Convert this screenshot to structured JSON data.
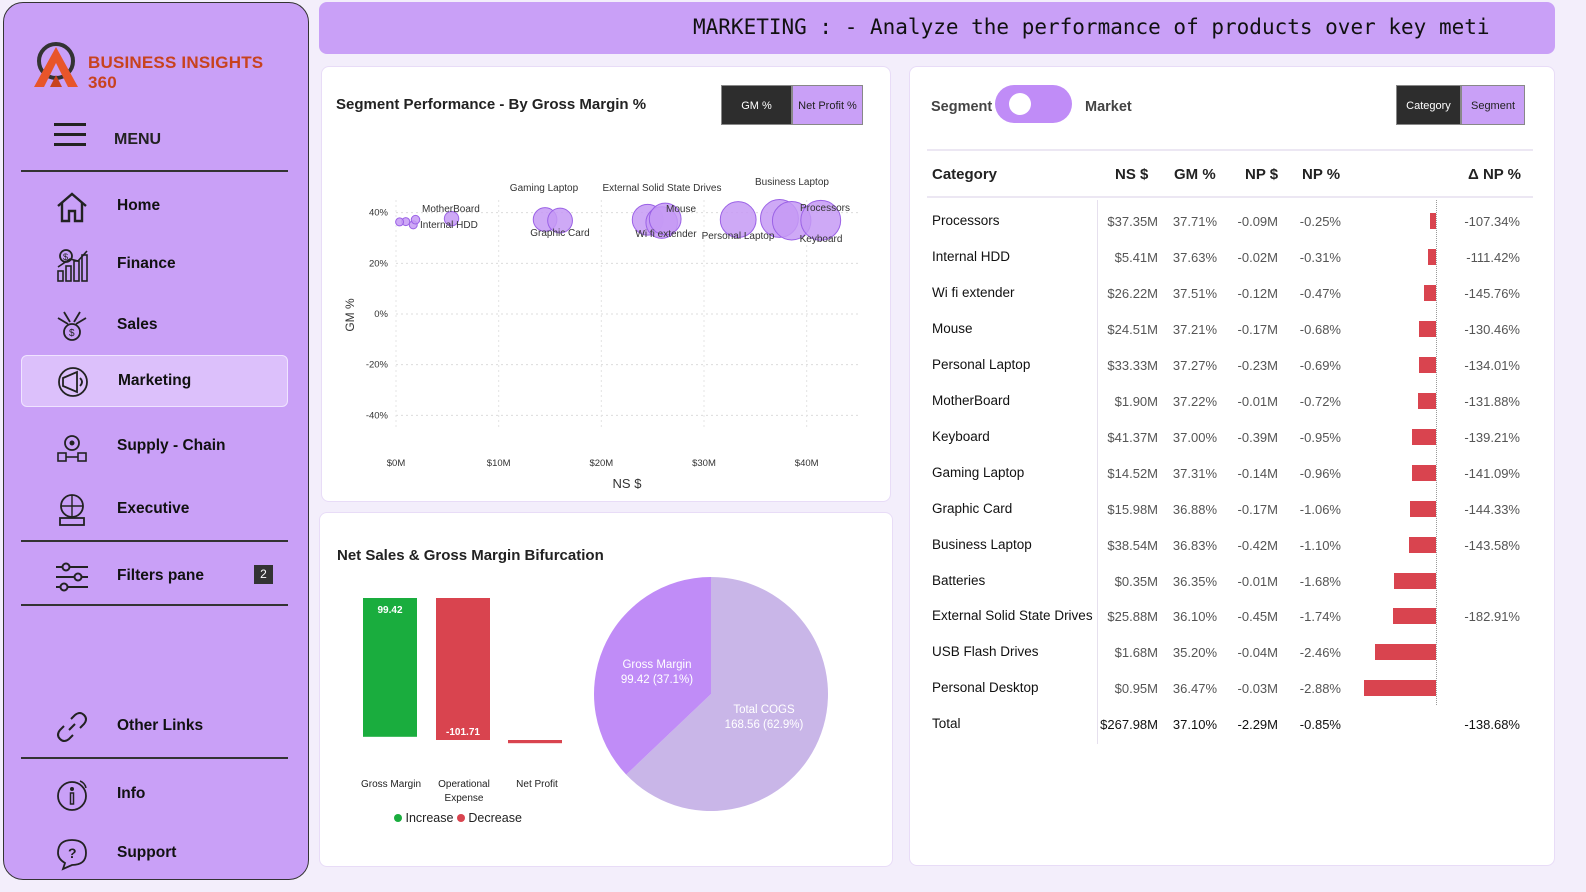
{
  "app": {
    "brand": "BUSINESS INSIGHTS 360",
    "banner_text": "MARKETING : - Analyze the performance of products over key meti"
  },
  "sidebar": {
    "menu_label": "MENU",
    "items": [
      {
        "label": "Home",
        "icon": "home-icon"
      },
      {
        "label": "Finance",
        "icon": "finance-icon"
      },
      {
        "label": "Sales",
        "icon": "sales-icon"
      },
      {
        "label": "Marketing",
        "icon": "marketing-icon",
        "active": true
      },
      {
        "label": "Supply - Chain",
        "icon": "supply-chain-icon"
      },
      {
        "label": "Executive",
        "icon": "executive-icon"
      },
      {
        "label": "Filters pane",
        "icon": "filters-icon",
        "badge": "2"
      },
      {
        "label": "Other Links",
        "icon": "link-icon"
      },
      {
        "label": "Info",
        "icon": "info-icon"
      },
      {
        "label": "Support",
        "icon": "support-icon"
      }
    ]
  },
  "segment_card": {
    "title": "Segment Performance - By Gross Margin %",
    "btn_gm": "GM %",
    "btn_np": "Net Profit %"
  },
  "bifurcation_card": {
    "title": "Net Sales & Gross Margin Bifurcation",
    "legend_increase": "Increase",
    "legend_decrease": "Decrease",
    "pie_gm_label": "Gross Margin",
    "pie_gm_value": "99.42 (37.1%)",
    "pie_cogs_label": "Total COGS",
    "pie_cogs_value": "168.56 (62.9%)"
  },
  "table_card": {
    "toggle_left": "Segment",
    "toggle_right": "Market",
    "btn_category": "Category",
    "btn_segment": "Segment",
    "headers": [
      "Category",
      "NS $",
      "GM %",
      "NP $",
      "NP %",
      "Δ NP %"
    ],
    "rows": [
      {
        "cat": "Processors",
        "ns": "$37.35M",
        "gm": "37.71%",
        "npd": "-0.09M",
        "npp": "-0.25%",
        "dnp": "-107.34%",
        "bar": -0.25
      },
      {
        "cat": "Internal HDD",
        "ns": "$5.41M",
        "gm": "37.63%",
        "npd": "-0.02M",
        "npp": "-0.31%",
        "dnp": "-111.42%",
        "bar": -0.31
      },
      {
        "cat": "Wi fi extender",
        "ns": "$26.22M",
        "gm": "37.51%",
        "npd": "-0.12M",
        "npp": "-0.47%",
        "dnp": "-145.76%",
        "bar": -0.47
      },
      {
        "cat": "Mouse",
        "ns": "$24.51M",
        "gm": "37.21%",
        "npd": "-0.17M",
        "npp": "-0.68%",
        "dnp": "-130.46%",
        "bar": -0.68
      },
      {
        "cat": "Personal Laptop",
        "ns": "$33.33M",
        "gm": "37.27%",
        "npd": "-0.23M",
        "npp": "-0.69%",
        "dnp": "-134.01%",
        "bar": -0.69
      },
      {
        "cat": "MotherBoard",
        "ns": "$1.90M",
        "gm": "37.22%",
        "npd": "-0.01M",
        "npp": "-0.72%",
        "dnp": "-131.88%",
        "bar": -0.72
      },
      {
        "cat": "Keyboard",
        "ns": "$41.37M",
        "gm": "37.00%",
        "npd": "-0.39M",
        "npp": "-0.95%",
        "dnp": "-139.21%",
        "bar": -0.95
      },
      {
        "cat": "Gaming Laptop",
        "ns": "$14.52M",
        "gm": "37.31%",
        "npd": "-0.14M",
        "npp": "-0.96%",
        "dnp": "-141.09%",
        "bar": -0.96
      },
      {
        "cat": "Graphic Card",
        "ns": "$15.98M",
        "gm": "36.88%",
        "npd": "-0.17M",
        "npp": "-1.06%",
        "dnp": "-144.33%",
        "bar": -1.06
      },
      {
        "cat": "Business Laptop",
        "ns": "$38.54M",
        "gm": "36.83%",
        "npd": "-0.42M",
        "npp": "-1.10%",
        "dnp": "-143.58%",
        "bar": -1.1
      },
      {
        "cat": "Batteries",
        "ns": "$0.35M",
        "gm": "36.35%",
        "npd": "-0.01M",
        "npp": "-1.68%",
        "dnp": "",
        "bar": -1.68
      },
      {
        "cat": "External Solid State Drives",
        "ns": "$25.88M",
        "gm": "36.10%",
        "npd": "-0.45M",
        "npp": "-1.74%",
        "dnp": "-182.91%",
        "bar": -1.74
      },
      {
        "cat": "USB Flash Drives",
        "ns": "$1.68M",
        "gm": "35.20%",
        "npd": "-0.04M",
        "npp": "-2.46%",
        "dnp": "",
        "bar": -2.46
      },
      {
        "cat": "Personal Desktop",
        "ns": "$0.95M",
        "gm": "36.47%",
        "npd": "-0.03M",
        "npp": "-2.88%",
        "dnp": "",
        "bar": -2.88
      }
    ],
    "total": {
      "cat": "Total",
      "ns": "$267.98M",
      "gm": "37.10%",
      "npd": "-2.29M",
      "npp": "-0.85%",
      "dnp": "-138.68%"
    }
  },
  "chart_data": [
    {
      "type": "scatter",
      "title": "Segment Performance - By Gross Margin %",
      "xlabel": "NS $",
      "ylabel": "GM %",
      "xlim": [
        0,
        45
      ],
      "ylim": [
        -45,
        45
      ],
      "x_ticks": [
        "$0M",
        "$10M",
        "$20M",
        "$30M",
        "$40M"
      ],
      "y_ticks": [
        "40%",
        "20%",
        "0%",
        "-20%",
        "-40%"
      ],
      "color": "#c59af5",
      "points": [
        {
          "label": "Personal Desktop",
          "x": 0.95,
          "y": 36.47
        },
        {
          "label": "Batteries",
          "x": 0.35,
          "y": 36.35
        },
        {
          "label": "USB Flash Drives",
          "x": 1.68,
          "y": 35.2
        },
        {
          "label": "MotherBoard",
          "x": 1.9,
          "y": 37.22
        },
        {
          "label": "Internal HDD",
          "x": 5.41,
          "y": 37.63
        },
        {
          "label": "Gaming Laptop",
          "x": 14.52,
          "y": 37.31
        },
        {
          "label": "Graphic Card",
          "x": 15.98,
          "y": 36.88
        },
        {
          "label": "Mouse",
          "x": 24.51,
          "y": 37.21
        },
        {
          "label": "External Solid State Drives",
          "x": 25.88,
          "y": 36.1
        },
        {
          "label": "Wi fi extender",
          "x": 26.22,
          "y": 37.51
        },
        {
          "label": "Personal Laptop",
          "x": 33.33,
          "y": 37.27
        },
        {
          "label": "Processors",
          "x": 37.35,
          "y": 37.71
        },
        {
          "label": "Business Laptop",
          "x": 38.54,
          "y": 36.83
        },
        {
          "label": "Keyboard",
          "x": 41.37,
          "y": 37.0
        }
      ]
    },
    {
      "type": "bar",
      "title": "Net Sales & Gross Margin Bifurcation",
      "categories": [
        "Gross Margin",
        "Operational Expense",
        "Net Profit"
      ],
      "values": [
        99.42,
        -101.71,
        -2.29
      ],
      "colors": {
        "increase": "#1aad3e",
        "decrease": "#d9444f"
      }
    },
    {
      "type": "pie",
      "slices": [
        {
          "label": "Gross Margin",
          "value": 99.42,
          "pct": 37.1,
          "color": "#c08cf7"
        },
        {
          "label": "Total COGS",
          "value": 168.56,
          "pct": 62.9,
          "color": "#c9b6e8"
        }
      ]
    }
  ]
}
